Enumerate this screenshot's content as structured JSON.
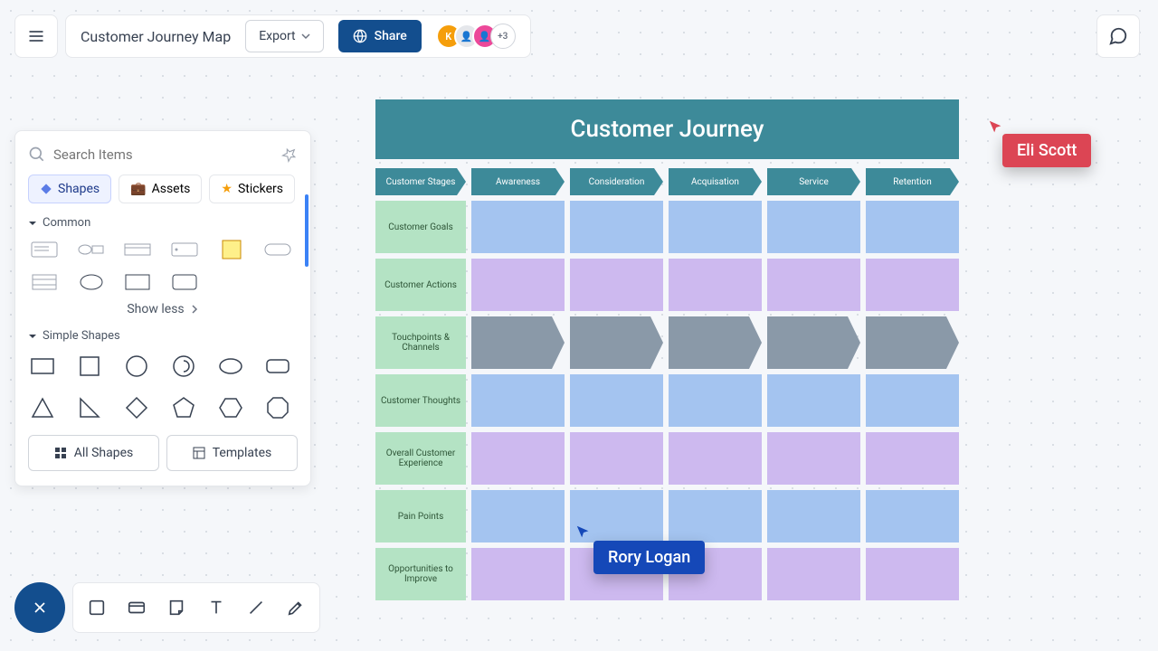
{
  "header": {
    "title": "Customer Journey Map",
    "export_label": "Export",
    "share_label": "Share",
    "extra_count": "+3"
  },
  "sidebar": {
    "search_placeholder": "Search Items",
    "tabs": {
      "shapes": "Shapes",
      "assets": "Assets",
      "stickers": "Stickers"
    },
    "sections": {
      "common": "Common",
      "simple": "Simple Shapes"
    },
    "show_less": "Show less",
    "buttons": {
      "all_shapes": "All Shapes",
      "templates": "Templates"
    }
  },
  "canvas": {
    "title": "Customer Journey",
    "stages": [
      "Customer Stages",
      "Awareness",
      "Consideration",
      "Acquisation",
      "Service",
      "Retention"
    ],
    "rows": [
      {
        "label": "Customer Goals",
        "color": "blue"
      },
      {
        "label": "Customer Actions",
        "color": "purple"
      },
      {
        "label": "Touchpoints & Channels",
        "color": "arrow"
      },
      {
        "label": "Customer Thoughts",
        "color": "blue"
      },
      {
        "label": "Overall Customer Experience",
        "color": "purple"
      },
      {
        "label": "Pain Points",
        "color": "blue"
      },
      {
        "label": "Opportunities to Improve",
        "color": "purple"
      }
    ]
  },
  "cursors": {
    "eli": "Eli Scott",
    "rory": "Rory Logan"
  }
}
